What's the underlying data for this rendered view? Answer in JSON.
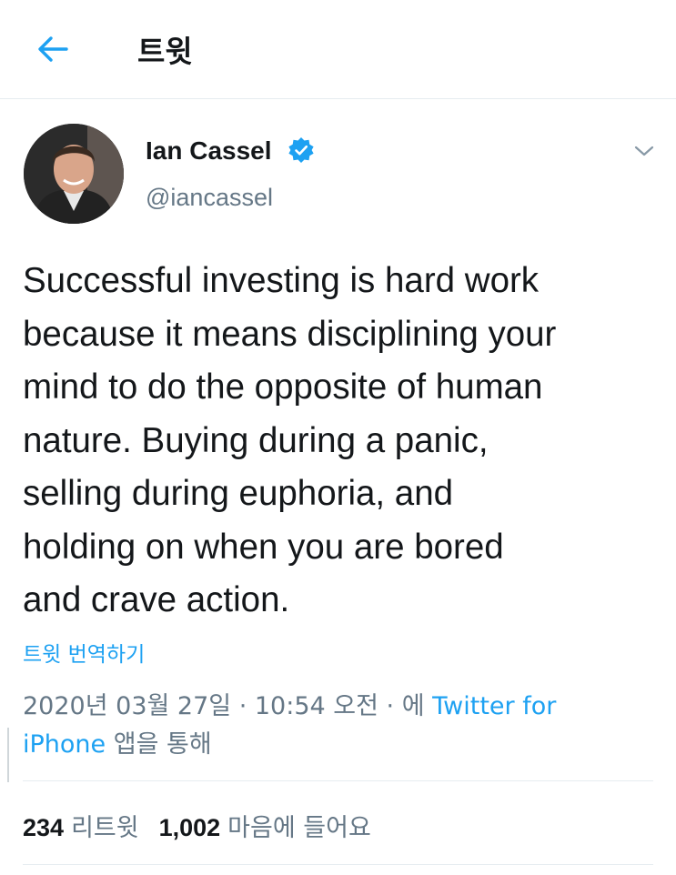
{
  "header": {
    "back_icon": "arrow-left-icon",
    "title": "트윗"
  },
  "author": {
    "display_name": "Ian Cassel",
    "verified_icon": "verified-badge-icon",
    "handle": "@iancassel",
    "menu_icon": "chevron-down-icon"
  },
  "tweet": {
    "text": "Successful investing is hard work\nbecause it means disciplining your\nmind to do the opposite of human\nnature. Buying during a panic,\nselling during euphoria, and\nholding on when you are bored\nand crave action.",
    "translate_label": "트윗 번역하기"
  },
  "meta": {
    "date": "2020년 03월 27일",
    "separator": " · ",
    "time": "10:54 오전",
    "via_prefix": "에 ",
    "source_line1": "Twitter for",
    "source_line2": "iPhone",
    "via_suffix": " 앱을 통해"
  },
  "stats": {
    "retweet_count": "234",
    "retweet_label": "리트윗",
    "like_count": "1,002",
    "like_label": "마음에 들어요"
  },
  "colors": {
    "accent": "#1da1f2",
    "secondary_text": "#657786",
    "primary_text": "#14171a",
    "divider": "#e6ecf0"
  }
}
